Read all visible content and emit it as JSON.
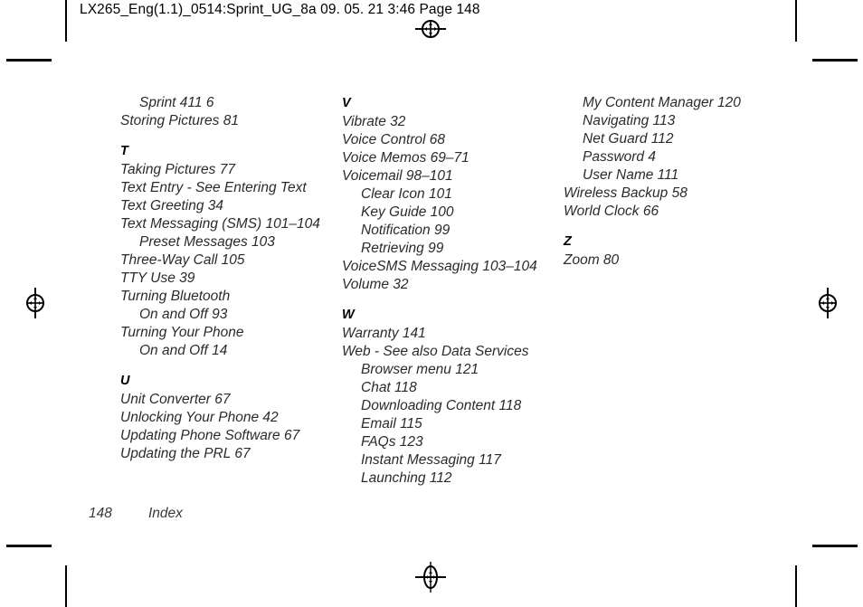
{
  "page": {
    "header_slug": "LX265_Eng(1.1)_0514:Sprint_UG_8a  09. 05. 21    3:46  Page 148",
    "footer": {
      "folio": "148",
      "label": "Index"
    }
  },
  "marks": {
    "registration_top": "registration-target",
    "registration_bottom": "registration-target",
    "registration_left": "registration-target",
    "registration_right": "registration-target"
  },
  "index": {
    "columns": [
      {
        "id": "column-1",
        "blocks": [
          {
            "letter": null,
            "entries": [
              {
                "text": "Sprint 411  6",
                "level": "sub"
              },
              {
                "text": "Storing Pictures  81",
                "level": "main"
              }
            ]
          },
          {
            "letter": "T",
            "entries": [
              {
                "text": "Taking Pictures  77",
                "level": "main"
              },
              {
                "text": "Text Entry - See Entering Text",
                "level": "main"
              },
              {
                "text": "Text Greeting  34",
                "level": "main"
              },
              {
                "text": "Text Messaging (SMS)  101–104",
                "level": "main"
              },
              {
                "text": "Preset Messages  103",
                "level": "sub"
              },
              {
                "text": "Three-Way Call  105",
                "level": "main"
              },
              {
                "text": "TTY Use  39",
                "level": "main"
              },
              {
                "text": "Turning Bluetooth",
                "level": "main"
              },
              {
                "text": "On and Off  93",
                "level": "sub"
              },
              {
                "text": "Turning Your Phone",
                "level": "main"
              },
              {
                "text": "On and Off  14",
                "level": "sub"
              }
            ]
          },
          {
            "letter": "U",
            "entries": [
              {
                "text": "Unit Converter  67",
                "level": "main"
              },
              {
                "text": "Unlocking Your Phone  42",
                "level": "main"
              },
              {
                "text": "Updating Phone Software  67",
                "level": "main"
              },
              {
                "text": "Updating the PRL  67",
                "level": "main"
              }
            ]
          }
        ]
      },
      {
        "id": "column-2",
        "blocks": [
          {
            "letter": "V",
            "entries": [
              {
                "text": "Vibrate  32",
                "level": "main"
              },
              {
                "text": "Voice Control  68",
                "level": "main"
              },
              {
                "text": "Voice Memos  69–71",
                "level": "main"
              },
              {
                "text": "Voicemail  98–101",
                "level": "main"
              },
              {
                "text": "Clear Icon  101",
                "level": "sub"
              },
              {
                "text": "Key Guide  100",
                "level": "sub"
              },
              {
                "text": "Notification  99",
                "level": "sub"
              },
              {
                "text": "Retrieving  99",
                "level": "sub"
              },
              {
                "text": "VoiceSMS Messaging  103–104",
                "level": "main"
              },
              {
                "text": "Volume  32",
                "level": "main"
              }
            ]
          },
          {
            "letter": "W",
            "entries": [
              {
                "text": "Warranty  141",
                "level": "main"
              },
              {
                "text": "Web - See also Data Services",
                "level": "main"
              },
              {
                "text": "Browser menu  121",
                "level": "sub"
              },
              {
                "text": "Chat  118",
                "level": "sub"
              },
              {
                "text": "Downloading Content  118",
                "level": "sub"
              },
              {
                "text": "Email  115",
                "level": "sub"
              },
              {
                "text": "FAQs  123",
                "level": "sub"
              },
              {
                "text": "Instant Messaging  117",
                "level": "sub"
              },
              {
                "text": "Launching  112",
                "level": "sub"
              }
            ]
          }
        ]
      },
      {
        "id": "column-3",
        "blocks": [
          {
            "letter": null,
            "entries": [
              {
                "text": "My Content Manager  120",
                "level": "sub"
              },
              {
                "text": "Navigating  113",
                "level": "sub"
              },
              {
                "text": "Net Guard  112",
                "level": "sub"
              },
              {
                "text": "Password  4",
                "level": "sub"
              },
              {
                "text": "User Name  111",
                "level": "sub"
              },
              {
                "text": "Wireless Backup  58",
                "level": "main"
              },
              {
                "text": "World Clock  66",
                "level": "main"
              }
            ]
          },
          {
            "letter": "Z",
            "entries": [
              {
                "text": "Zoom  80",
                "level": "main"
              }
            ]
          }
        ]
      }
    ]
  }
}
